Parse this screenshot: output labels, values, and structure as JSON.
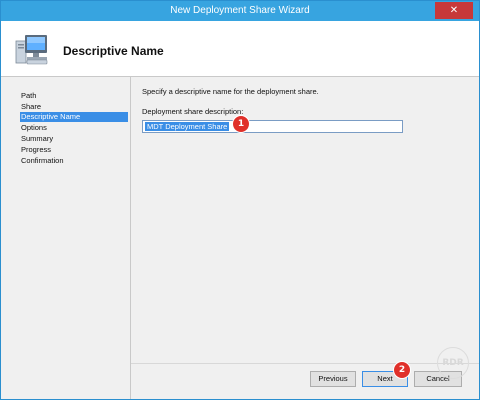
{
  "window": {
    "title": "New Deployment Share Wizard",
    "close_glyph": "✕"
  },
  "header": {
    "title": "Descriptive Name",
    "icon": "computer-icon"
  },
  "sidebar": {
    "items": [
      {
        "label": "Path",
        "active": false
      },
      {
        "label": "Share",
        "active": false
      },
      {
        "label": "Descriptive Name",
        "active": true
      },
      {
        "label": "Options",
        "active": false
      },
      {
        "label": "Summary",
        "active": false
      },
      {
        "label": "Progress",
        "active": false
      },
      {
        "label": "Confirmation",
        "active": false
      }
    ]
  },
  "main": {
    "instruction": "Specify a descriptive name for the deployment share.",
    "field_label": "Deployment share description:",
    "field_value": "MDT Deployment Share"
  },
  "annotations": {
    "badge1": "1",
    "badge2": "2"
  },
  "buttons": {
    "previous": "Previous",
    "next": "Next",
    "cancel": "Cancel"
  },
  "watermark": "RDR",
  "colors": {
    "titlebar": "#37a4e0",
    "selection": "#3a8ee6",
    "badge": "#e0302a",
    "close": "#c7383a"
  }
}
